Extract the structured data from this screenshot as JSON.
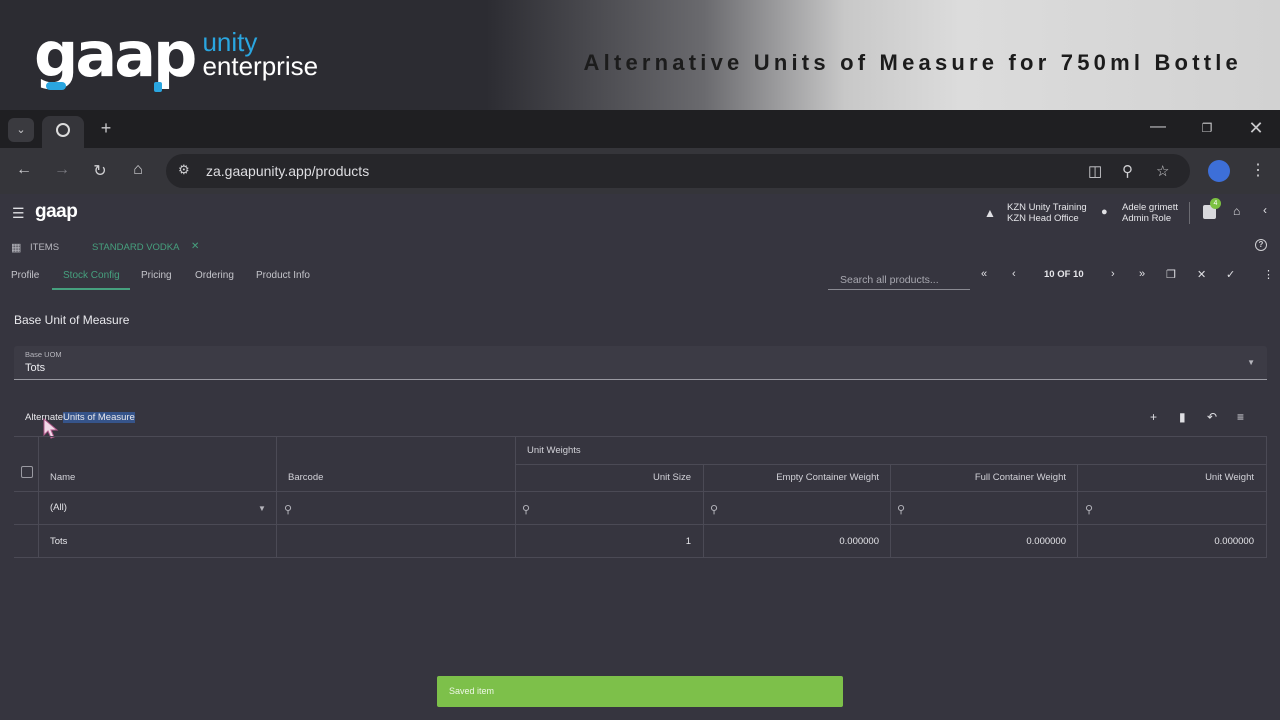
{
  "banner": {
    "logo_main": "gaap",
    "logo_unity": "unity",
    "logo_enterprise": "enterprise",
    "title": "Alternative Units of Measure for 750ml Bottle"
  },
  "browser": {
    "url": "za.gaapunity.app/products"
  },
  "app": {
    "logo": "gaap",
    "org_line1": "KZN Unity Training",
    "org_line2": "KZN Head Office",
    "user_name": "Adele grimett",
    "user_role": "Admin Role",
    "notification_count": "4"
  },
  "doc_tabs": {
    "items_label": "ITEMS",
    "active_label": "STANDARD VODKA"
  },
  "sub_tabs": [
    "Profile",
    "Stock Config",
    "Pricing",
    "Ordering",
    "Product Info"
  ],
  "toolbar": {
    "search_placeholder": "Search all products...",
    "pager": "10 OF 10"
  },
  "base_uom": {
    "section_title": "Base Unit of Measure",
    "field_label": "Base UOM",
    "field_value": "Tots"
  },
  "alt_uom": {
    "title_plain": "Alternate",
    "title_highlight": "Units of Measure"
  },
  "grid": {
    "group_header": "Unit Weights",
    "columns": [
      "Name",
      "Barcode",
      "Unit Size",
      "Empty Container Weight",
      "Full Container Weight",
      "Unit Weight"
    ],
    "filter_name_value": "(All)",
    "rows": [
      {
        "name": "Tots",
        "barcode": "",
        "unit_size": "1",
        "empty_weight": "0.000000",
        "full_weight": "0.000000",
        "unit_weight": "0.000000"
      }
    ]
  },
  "toast": {
    "message": "Saved item"
  }
}
